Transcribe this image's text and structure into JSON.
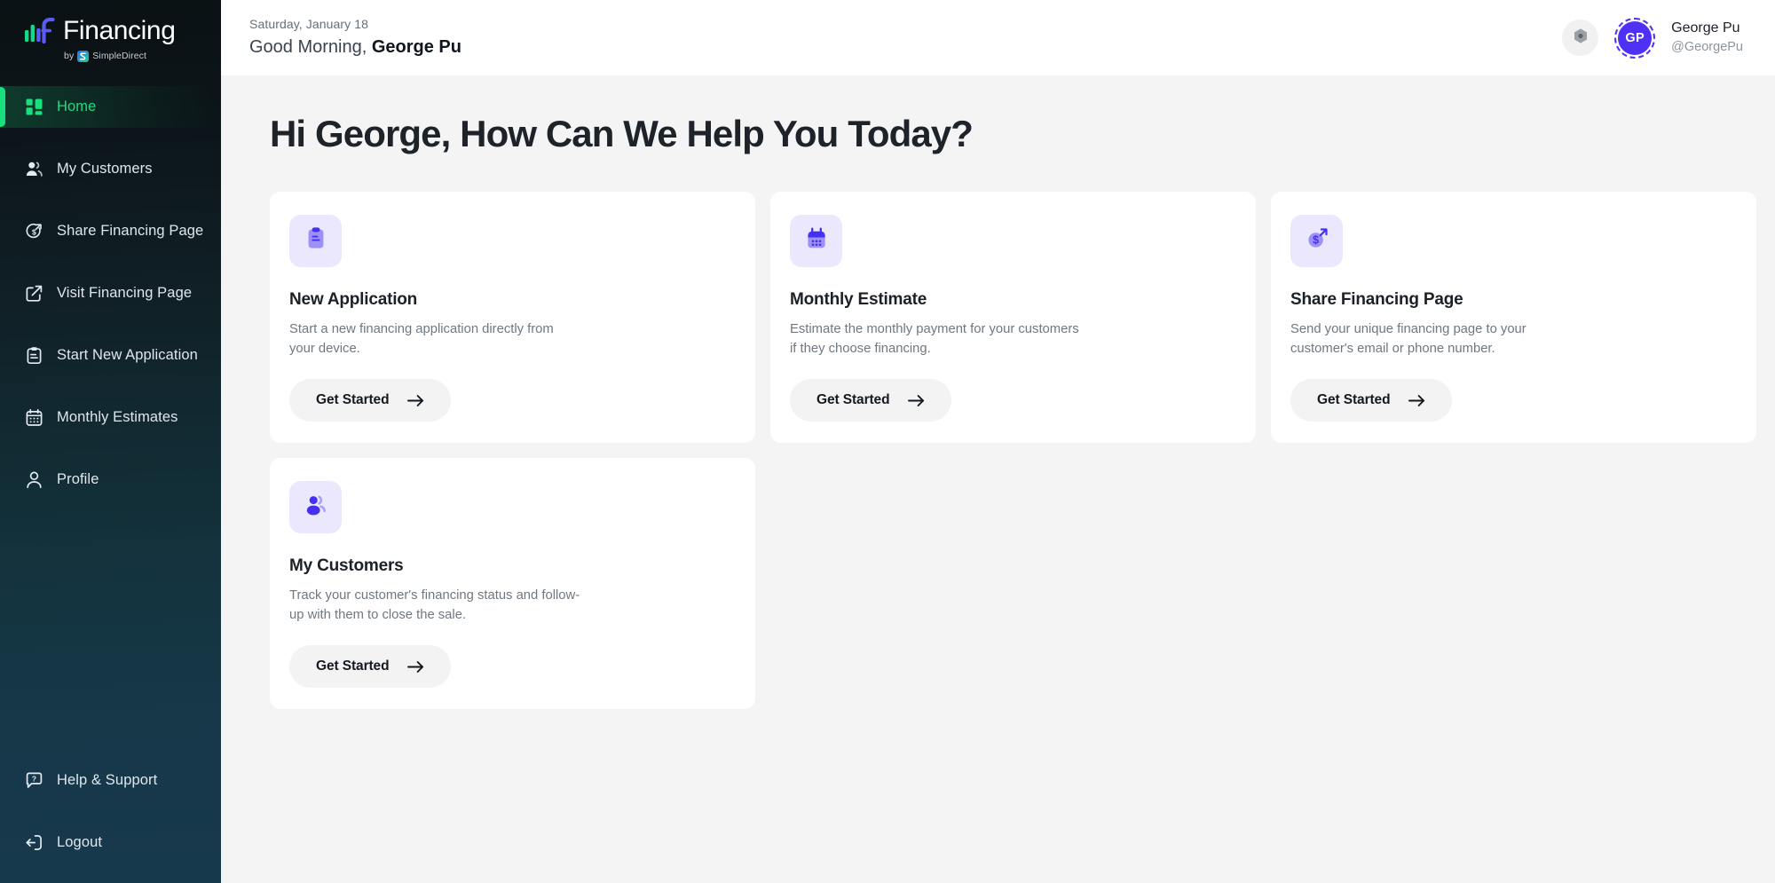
{
  "brand": {
    "name": "Financing",
    "by_prefix": "by",
    "by_company": "SimpleDirect",
    "accent_green": "#19e07f",
    "accent_blue": "#4f46e5"
  },
  "sidebar": {
    "items": [
      {
        "label": "Home",
        "icon": "grid-icon",
        "active": true
      },
      {
        "label": "My Customers",
        "icon": "users-icon",
        "active": false
      },
      {
        "label": "Share Financing Page",
        "icon": "dollar-share-icon",
        "active": false
      },
      {
        "label": "Visit Financing Page",
        "icon": "external-link-icon",
        "active": false
      },
      {
        "label": "Start New Application",
        "icon": "clipboard-icon",
        "active": false
      },
      {
        "label": "Monthly Estimates",
        "icon": "calendar-icon",
        "active": false
      },
      {
        "label": "Profile",
        "icon": "user-icon",
        "active": false
      }
    ],
    "bottom_items": [
      {
        "label": "Help & Support",
        "icon": "help-bubble-icon"
      },
      {
        "label": "Logout",
        "icon": "logout-icon"
      }
    ]
  },
  "topbar": {
    "date": "Saturday, January 18",
    "greeting_prefix": "Good Morning,",
    "greeting_name": "George Pu",
    "settings_icon": "gear-icon",
    "user": {
      "initials": "GP",
      "name": "George Pu",
      "handle": "@GeorgePu",
      "avatar_color": "#4f31f5"
    }
  },
  "main": {
    "title": "Hi George, How Can We Help You Today?",
    "cards": [
      {
        "icon": "clipboard-icon",
        "title": "New Application",
        "desc": "Start a new financing application directly from your device.",
        "button": "Get Started"
      },
      {
        "icon": "calendar-icon",
        "title": "Monthly Estimate",
        "desc": "Estimate the monthly payment for your customers if they choose financing.",
        "button": "Get Started"
      },
      {
        "icon": "dollar-share-icon",
        "title": "Share Financing Page",
        "desc": "Send your unique financing page to your customer's email or phone number.",
        "button": "Get Started"
      },
      {
        "icon": "users-icon",
        "title": "My Customers",
        "desc": "Track your customer's financing status and follow-up with them to close the sale.",
        "button": "Get Started"
      }
    ]
  }
}
